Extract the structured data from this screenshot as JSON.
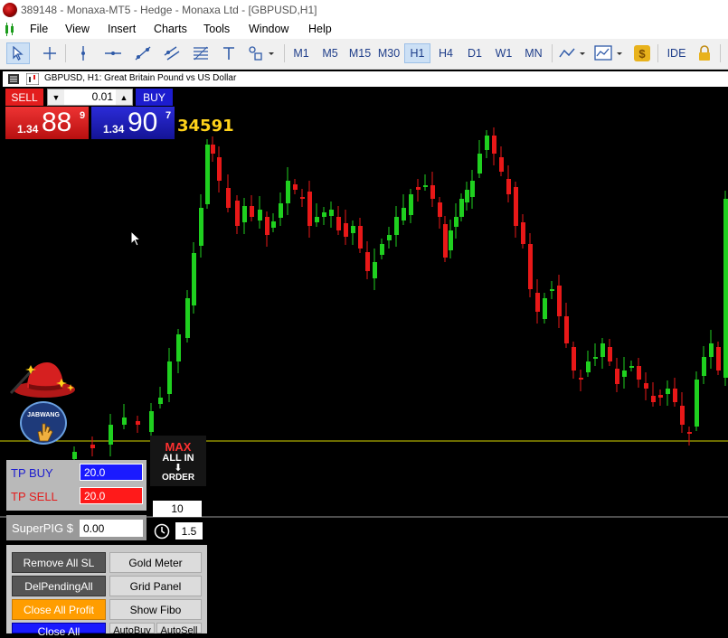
{
  "window": {
    "title": "389148 - Monaxa-MT5 - Hedge - Monaxa Ltd - [GBPUSD,H1]"
  },
  "menu": [
    "File",
    "View",
    "Insert",
    "Charts",
    "Tools",
    "Window",
    "Help"
  ],
  "toolbar": {
    "timeframes": [
      "M1",
      "M5",
      "M15",
      "M30",
      "H1",
      "H4",
      "D1",
      "W1",
      "MN"
    ],
    "active_timeframe": "H1",
    "ide_label": "IDE",
    "icons": [
      "cursor-icon",
      "crosshair-icon",
      "vertical-line-icon",
      "horizontal-line-icon",
      "trendline-icon",
      "channel-icon",
      "fibonacci-icon",
      "text-icon",
      "shapes-icon",
      "indicators-icon",
      "templates-icon",
      "dollar-icon",
      "lock-icon"
    ]
  },
  "chart": {
    "header": "GBPUSD, H1:  Great Britain Pound vs US Dollar",
    "bid_color": "#e31d1d",
    "ask_color": "#1c1ccf",
    "bull_color": "#1fd01f",
    "bear_color": "#e81818"
  },
  "trade_panel": {
    "sell_label": "SELL",
    "buy_label": "BUY",
    "lot": "0.01",
    "bid_prefix": "1.34",
    "bid_big": "88",
    "bid_sup": "9",
    "ask_prefix": "1.34",
    "ask_big": "90",
    "ask_sup": "7",
    "spread_value": "34591"
  },
  "logo": {
    "badge_text": "JABWANG"
  },
  "ea_panel": {
    "tp_buy_label": "TP BUY",
    "tp_buy_value": "20.0",
    "tp_sell_label": "TP SELL",
    "tp_sell_value": "20.0",
    "max_line1": "MAX",
    "max_line2": "ALL IN",
    "max_line3": "ORDER",
    "count_value": "10",
    "timer_value": "1.5",
    "superpig_label": "SuperPIG $",
    "superpig_value": "0.00",
    "buttons": {
      "remove_all_sl": "Remove All SL",
      "gold_meter": "Gold Meter",
      "del_pending_all": "DelPendingAll",
      "grid_panel": "Grid Panel",
      "close_all_profit": "Close All Profit",
      "show_fibo": "Show Fibo",
      "close_all": "Close All",
      "auto_buy": "AutoBuy",
      "auto_sell": "AutoSell"
    }
  }
}
